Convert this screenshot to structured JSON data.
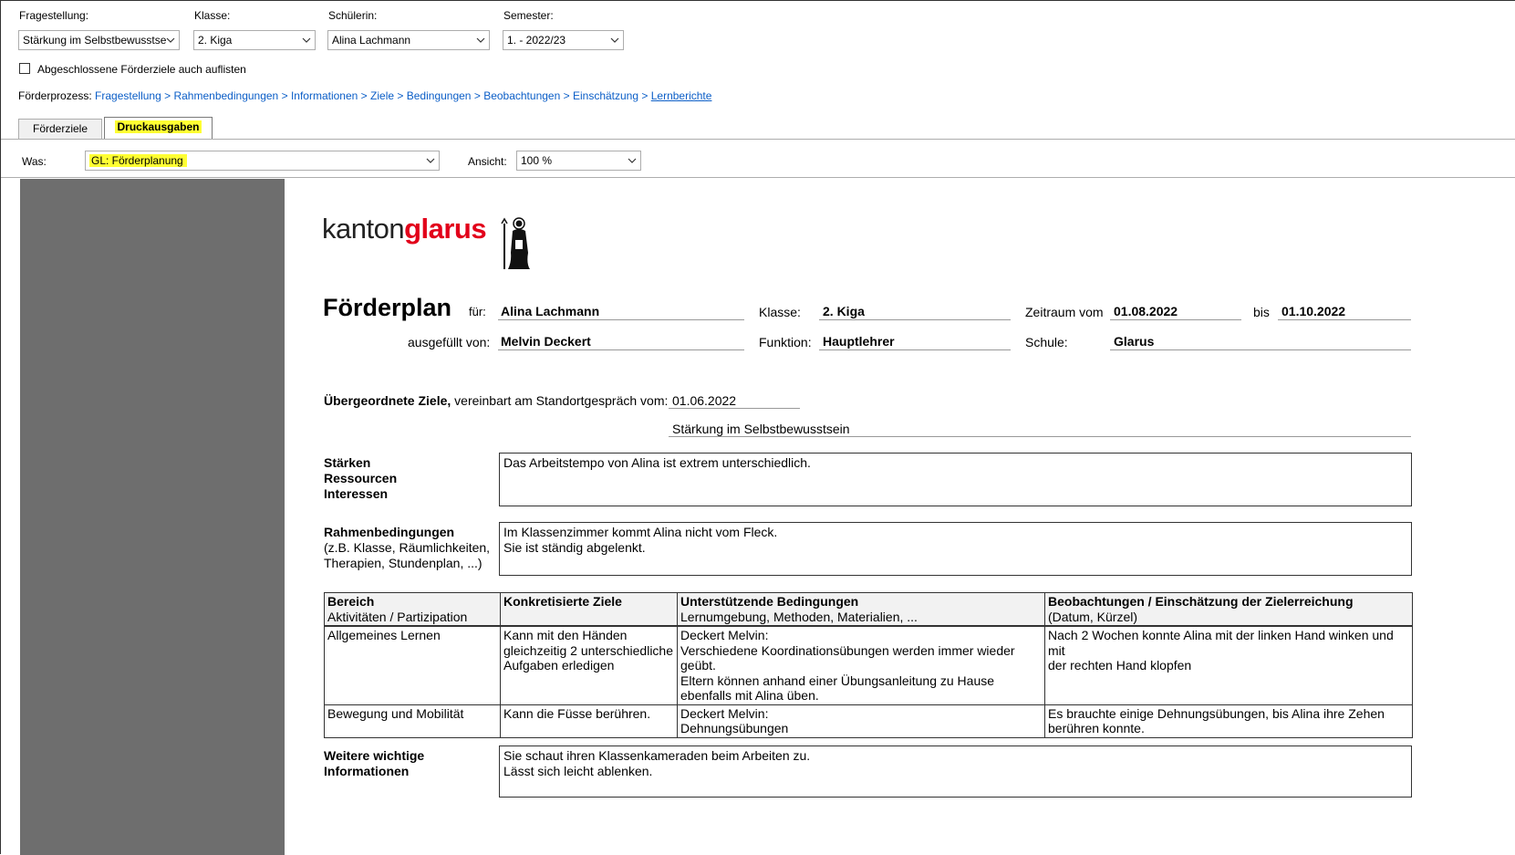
{
  "filters": {
    "fragestellung": {
      "label": "Fragestellung:",
      "value": "Stärkung im Selbstbewusstse"
    },
    "klasse": {
      "label": "Klasse:",
      "value": "2. Kiga"
    },
    "schuelerin": {
      "label": "Schülerin:",
      "value": "Alina Lachmann"
    },
    "semester": {
      "label": "Semester:",
      "value": "1. - 2022/23"
    }
  },
  "checkbox_label": "Abgeschlossene Förderziele auch auflisten",
  "breadcrumb": {
    "prefix": "Förderprozess:",
    "steps": [
      "Fragestellung",
      "Rahmenbedingungen",
      "Informationen",
      "Ziele",
      "Bedingungen",
      "Beobachtungen",
      "Einschätzung",
      "Lernberichte"
    ],
    "separator": ">"
  },
  "tabs": [
    {
      "label": "Förderziele"
    },
    {
      "label": "Druckausgaben"
    }
  ],
  "print_bar": {
    "was_label": "Was:",
    "was_value": "GL: Förderplanung",
    "ansicht_label": "Ansicht:",
    "ansicht_value": "100 %"
  },
  "colors": {
    "link": "#0b5ec7",
    "highlight": "#ffff33",
    "logo_red": "#e2001a",
    "preview_bg": "#6e6e6e"
  },
  "document": {
    "logo_word1": "kanton",
    "logo_word2": "glarus",
    "title": "Förderplan",
    "fuer_label": "für:",
    "fuer_value": "Alina Lachmann",
    "klasse_label": "Klasse:",
    "klasse_value": "2. Kiga",
    "zeitraum_label": "Zeitraum vom",
    "zeitraum_von": "01.08.2022",
    "bis_label": "bis",
    "zeitraum_bis": "01.10.2022",
    "ausgefuellt_label": "ausgefüllt von:",
    "ausgefuellt_value": "Melvin Deckert",
    "funktion_label": "Funktion:",
    "funktion_value": "Hauptlehrer",
    "schule_label": "Schule:",
    "schule_value": "Glarus",
    "ziele_label_bold": "Übergeordnete Ziele,",
    "ziele_label_rest": " vereinbart am Standortgespräch vom:",
    "ziele_datum": "01.06.2022",
    "ziele_text": "Stärkung im Selbstbewusstsein",
    "staerken_label": [
      "Stärken",
      "Ressourcen",
      "Interessen"
    ],
    "staerken_text": "Das Arbeitstempo von Alina ist extrem unterschiedlich.",
    "rahmen_label": "Rahmenbedingungen",
    "rahmen_sub": [
      "(z.B. Klasse, Räumlichkeiten,",
      "Therapien, Stundenplan, ...)"
    ],
    "rahmen_text": [
      "Im Klassenzimmer kommt Alina nicht vom Fleck.",
      "Sie ist ständig abgelenkt."
    ],
    "table": {
      "headers": [
        {
          "title": "Bereich",
          "sub": "Aktivitäten / Partizipation"
        },
        {
          "title": "Konkretisierte Ziele",
          "sub": ""
        },
        {
          "title": "Unterstützende Bedingungen",
          "sub": "Lernumgebung, Methoden, Materialien, ..."
        },
        {
          "title": "Beobachtungen / Einschätzung der Zielerreichung",
          "sub": "(Datum, Kürzel)"
        }
      ],
      "rows": [
        {
          "bereich": "Allgemeines Lernen",
          "ziele": [
            "Kann mit den Händen",
            "gleichzeitig 2 unterschiedliche",
            "Aufgaben erledigen"
          ],
          "bedingungen": [
            "Deckert Melvin:",
            "Verschiedene Koordinationsübungen werden immer wieder geübt.",
            "Eltern können anhand einer Übungsanleitung zu Hause",
            "ebenfalls mit Alina üben."
          ],
          "beobachtungen": [
            "Nach 2 Wochen konnte Alina mit der linken Hand winken und mit",
            "der rechten Hand klopfen"
          ]
        },
        {
          "bereich": "Bewegung und Mobilität",
          "ziele": [
            "Kann die Füsse berühren."
          ],
          "bedingungen": [
            "Deckert Melvin:",
            "Dehnungsübungen"
          ],
          "beobachtungen": [
            "Es brauchte einige Dehnungsübungen, bis Alina ihre Zehen",
            "berühren konnte."
          ]
        }
      ]
    },
    "weitere_label": [
      "Weitere wichtige",
      "Informationen"
    ],
    "weitere_text": [
      "Sie schaut ihren Klassenkameraden beim Arbeiten zu.",
      "Lässt sich leicht ablenken."
    ]
  }
}
